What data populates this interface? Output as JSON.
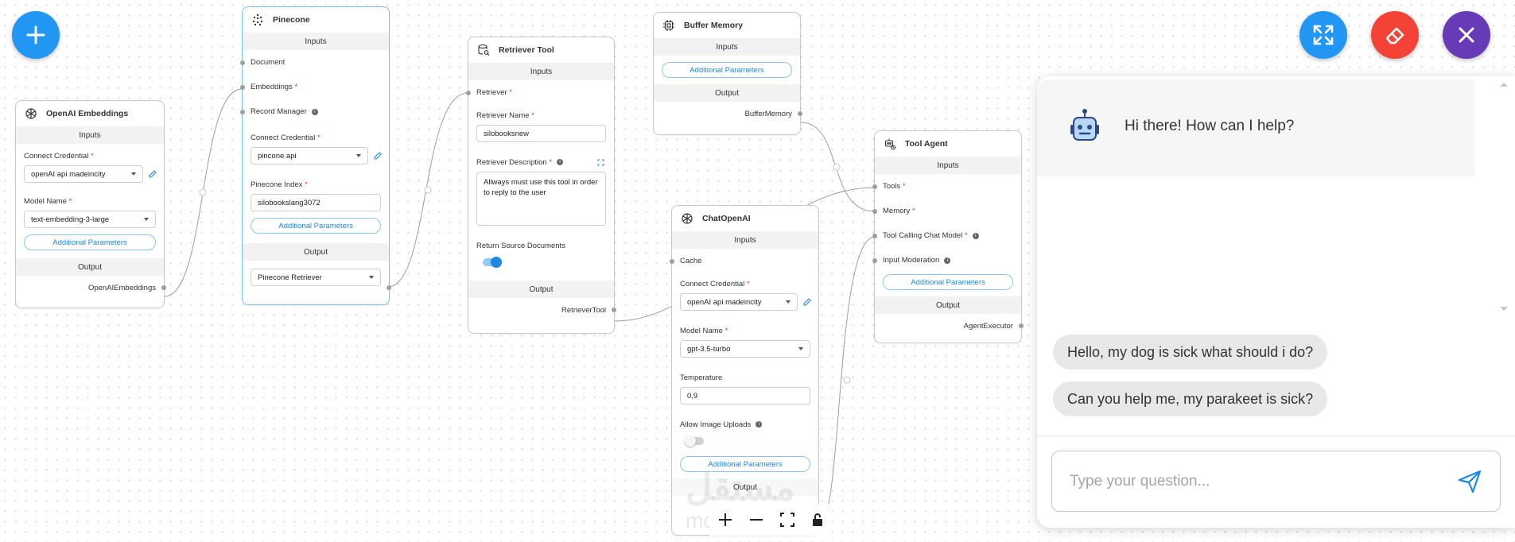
{
  "fab_add": {
    "icon": "plus-icon",
    "color": "#1e88e5"
  },
  "top_actions": [
    {
      "name": "expand",
      "icon": "expand-arrows-icon",
      "color": "#2196f3"
    },
    {
      "name": "clear",
      "icon": "eraser-icon",
      "color": "#f44336"
    },
    {
      "name": "close",
      "icon": "close-icon",
      "color": "#673ab7"
    }
  ],
  "nodes": {
    "openai_embeddings": {
      "title": "OpenAI Embeddings",
      "inputs_label": "Inputs",
      "connect_credential_label": "Connect Credential",
      "credential_value": "openAI api madeincity",
      "model_name_label": "Model Name",
      "model_name_value": "text-embedding-3-large",
      "additional_params": "Additional Parameters",
      "output_label": "Output",
      "output_name": "OpenAIEmbeddings"
    },
    "pinecone": {
      "title": "Pinecone",
      "inputs_label": "Inputs",
      "document_label": "Document",
      "embeddings_label": "Embeddings",
      "record_manager_label": "Record Manager",
      "connect_credential_label": "Connect Credential",
      "credential_value": "pincone api",
      "index_label": "Pinecone Index",
      "index_value": "silobookslang3072",
      "additional_params": "Additional Parameters",
      "output_label": "Output",
      "output_value": "Pinecone Retriever"
    },
    "retriever_tool": {
      "title": "Retriever Tool",
      "inputs_label": "Inputs",
      "retriever_label": "Retriever",
      "retriever_name_label": "Retriever Name",
      "retriever_name_value": "silobooksnew",
      "retriever_desc_label": "Retriever Description",
      "retriever_desc_value": "Allways must use this tool in order to reply to the user",
      "return_source_label": "Return Source Documents",
      "output_label": "Output",
      "output_name": "RetrieverTool"
    },
    "buffer_memory": {
      "title": "Buffer Memory",
      "inputs_label": "Inputs",
      "additional_params": "Additional Parameters",
      "output_label": "Output",
      "output_name": "BufferMemory"
    },
    "chat_openai": {
      "title": "ChatOpenAI",
      "inputs_label": "Inputs",
      "cache_label": "Cache",
      "connect_credential_label": "Connect Credential",
      "credential_value": "openAI api madeincity",
      "model_name_label": "Model Name",
      "model_name_value": "gpt-3.5-turbo",
      "temperature_label": "Temperature",
      "temperature_value": "0,9",
      "allow_image_label": "Allow Image Uploads",
      "additional_params": "Additional Parameters",
      "output_label": "Output"
    },
    "tool_agent": {
      "title": "Tool Agent",
      "inputs_label": "Inputs",
      "tools_label": "Tools",
      "memory_label": "Memory",
      "chat_model_label": "Tool Calling Chat Model",
      "input_moderation_label": "Input Moderation",
      "additional_params": "Additional Parameters",
      "output_label": "Output",
      "output_name": "AgentExecutor"
    }
  },
  "chat": {
    "greeting": "Hi there! How can I help?",
    "messages": [
      "Hello, my dog is sick what should i do?",
      "Can you help me, my parakeet is sick?"
    ],
    "input_placeholder": "Type your question...",
    "send_icon": "send-icon"
  },
  "watermark": {
    "arabic": "مستقل",
    "latin": "mostaql.com"
  },
  "canvas_controls": [
    "zoom-in-icon",
    "zoom-out-icon",
    "fit-view-icon",
    "lock-icon"
  ]
}
